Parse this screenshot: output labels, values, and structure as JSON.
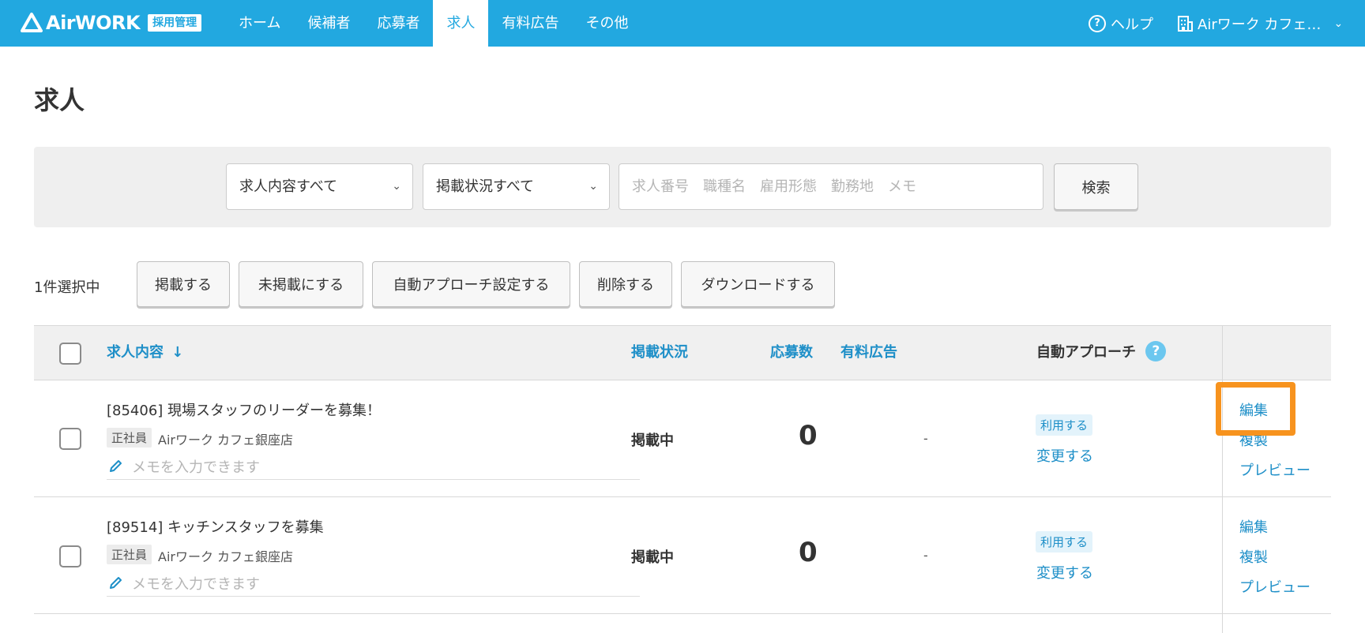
{
  "header": {
    "logo_text": "AirWORK",
    "logo_badge": "採用管理",
    "nav": [
      {
        "label": "ホーム",
        "active": false
      },
      {
        "label": "候補者",
        "active": false
      },
      {
        "label": "応募者",
        "active": false
      },
      {
        "label": "求人",
        "active": true
      },
      {
        "label": "有料広告",
        "active": false
      },
      {
        "label": "その他",
        "active": false
      }
    ],
    "help_label": "ヘルプ",
    "store_label": "Airワーク カフェ…",
    "brand_color": "#22a8e0"
  },
  "page": {
    "title": "求人"
  },
  "search": {
    "content_select": "求人内容すべて",
    "status_select": "掲載状況すべて",
    "keyword_placeholder": "求人番号　職種名　雇用形態　勤務地　メモ",
    "keyword_value": "",
    "search_label": "検索"
  },
  "bulk": {
    "selected_text": "1件選択中",
    "publish_label": "掲載する",
    "unpublish_label": "未掲載にする",
    "auto_approach_label": "自動アプローチ設定する",
    "delete_label": "削除する",
    "download_label": "ダウンロードする"
  },
  "table": {
    "headers": {
      "content": "求人内容",
      "status": "掲載状況",
      "applications": "応募数",
      "paid_ad": "有料広告",
      "auto_approach": "自動アプローチ"
    },
    "rows": [
      {
        "title": "[85406] 現場スタッフのリーダーを募集！",
        "employment": "正社員",
        "store": "Airワーク カフェ銀座店",
        "memo_placeholder": "メモを入力できます",
        "status": "掲載中",
        "applications": "0",
        "paid_ad": "-",
        "auto_badge": "利用する",
        "change_label": "変更する",
        "actions": {
          "edit": "編集",
          "copy": "複製",
          "preview": "プレビュー"
        }
      },
      {
        "title": "[89514] キッチンスタッフを募集",
        "employment": "正社員",
        "store": "Airワーク カフェ銀座店",
        "memo_placeholder": "メモを入力できます",
        "status": "掲載中",
        "applications": "0",
        "paid_ad": "-",
        "auto_badge": "利用する",
        "change_label": "変更する",
        "actions": {
          "edit": "編集",
          "copy": "複製",
          "preview": "プレビュー"
        }
      }
    ]
  },
  "highlight_color": "#f7931e"
}
